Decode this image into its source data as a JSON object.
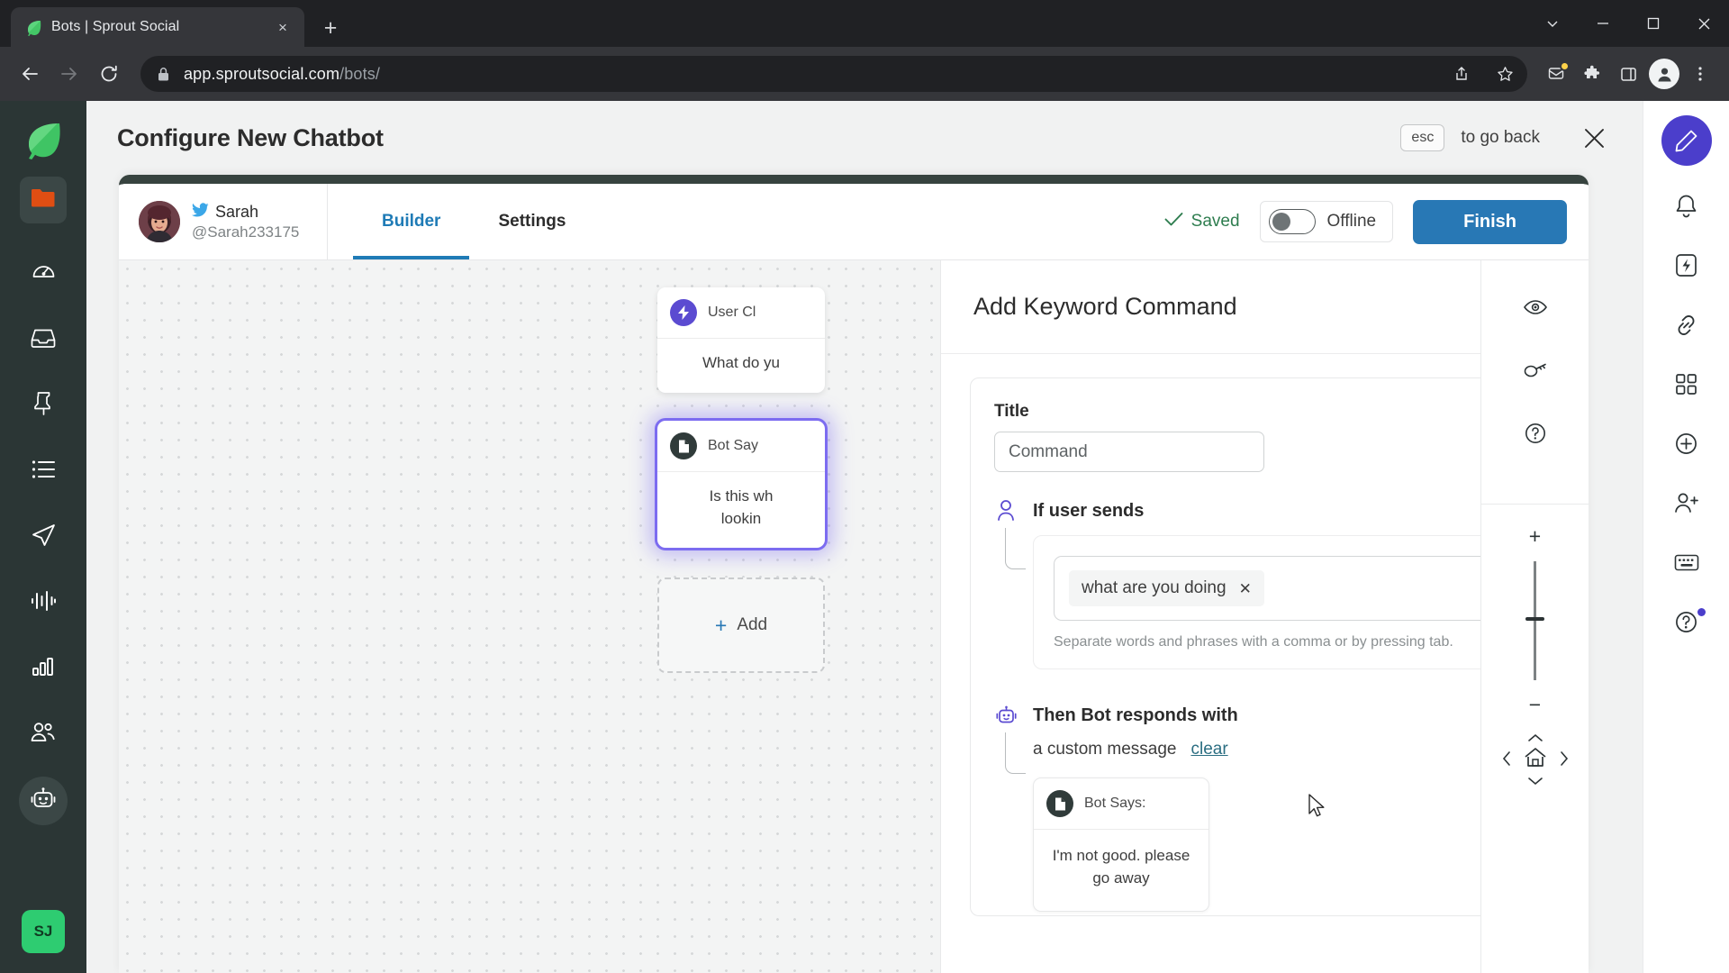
{
  "browser": {
    "tab": {
      "title": "Bots | Sprout Social",
      "favicon": "sprout-leaf-icon",
      "close": "×"
    },
    "new_tab_label": "+",
    "url_domain": "app.sproutsocial.com",
    "url_path": "/bots/",
    "window_controls": {
      "minimize": "minimize-icon",
      "maximize": "maximize-icon",
      "close": "close-icon",
      "chevron": "chevron-down-icon"
    }
  },
  "left_rail": {
    "logo": "sprout-logo-icon",
    "items": [
      {
        "name": "folder",
        "icon": "folder-icon"
      },
      {
        "name": "dashboard",
        "icon": "gauge-icon"
      },
      {
        "name": "smart-inbox",
        "icon": "inbox-icon"
      },
      {
        "name": "publishing",
        "icon": "pin-icon"
      },
      {
        "name": "tasks",
        "icon": "list-icon"
      },
      {
        "name": "send",
        "icon": "paper-plane-icon"
      },
      {
        "name": "listening",
        "icon": "waveform-icon"
      },
      {
        "name": "reports",
        "icon": "bar-chart-icon"
      },
      {
        "name": "audience",
        "icon": "people-icon"
      },
      {
        "name": "bots",
        "icon": "robot-icon"
      }
    ],
    "user_initials": "SJ"
  },
  "header": {
    "title": "Configure New Chatbot",
    "esc_key": "esc",
    "esc_text": "to go back",
    "close_icon": "close-icon"
  },
  "builder": {
    "account": {
      "name": "Sarah",
      "handle": "@Sarah233175",
      "network_icon": "twitter-icon",
      "avatar": "user-avatar"
    },
    "tabs": [
      {
        "label": "Builder",
        "active": true
      },
      {
        "label": "Settings",
        "active": false
      }
    ],
    "saved_label": "Saved",
    "saved_icon": "check-icon",
    "status_toggle": {
      "label": "Offline",
      "on": false
    },
    "finish_label": "Finish"
  },
  "canvas": {
    "nodes": [
      {
        "type": "user-click",
        "title": "User Cl",
        "icon": "lightning-icon",
        "body": "What do yu"
      },
      {
        "type": "bot-says",
        "title": "Bot Say",
        "icon": "document-icon",
        "body": "Is this wh\nlookin",
        "selected": true
      }
    ],
    "add_node_label": "Add",
    "add_node_plus": "+"
  },
  "drawer": {
    "title": "Add Keyword Command",
    "title_field": {
      "label": "Title",
      "value": "Command",
      "placeholder": "Command"
    },
    "delete_icon": "trash-icon",
    "if_user_sends": {
      "label": "If user sends",
      "icon": "user-icon",
      "tags": [
        {
          "text": "what are you doing",
          "remove": "✕"
        }
      ],
      "hint": "Separate words and phrases with a comma or by pressing tab."
    },
    "then_bot_responds": {
      "label": "Then Bot responds with",
      "icon": "robot-icon",
      "message_type": "a custom message",
      "clear_label": "clear",
      "bot_card": {
        "title": "Bot Says:",
        "icon": "document-icon",
        "body": "I'm not good. please go away"
      }
    }
  },
  "zoom_controls": {
    "items": [
      {
        "name": "preview",
        "icon": "eye-icon"
      },
      {
        "name": "permissions",
        "icon": "key-icon"
      },
      {
        "name": "help",
        "icon": "question-circle-icon"
      }
    ],
    "plus": "+",
    "minus": "−",
    "home_icon": "home-icon",
    "left": "‹",
    "right": "›",
    "up": "⌃",
    "down": "⌄"
  },
  "right_rail": {
    "compose_icon": "compose-icon",
    "items": [
      {
        "name": "notifications",
        "icon": "bell-icon"
      },
      {
        "name": "activity",
        "icon": "bolt-icon"
      },
      {
        "name": "links",
        "icon": "link-icon"
      },
      {
        "name": "apps",
        "icon": "grid-icon"
      },
      {
        "name": "add",
        "icon": "plus-circle-icon"
      },
      {
        "name": "invite",
        "icon": "person-add-icon"
      },
      {
        "name": "shortcuts",
        "icon": "keyboard-icon"
      },
      {
        "name": "help",
        "icon": "help-circle-icon"
      }
    ]
  },
  "colors": {
    "accent_blue": "#2878b5",
    "sprout_green": "#2ecc71",
    "purple": "#5b4bd1",
    "dark_rail": "#2b3635",
    "saved_green": "#2e7d4f"
  }
}
